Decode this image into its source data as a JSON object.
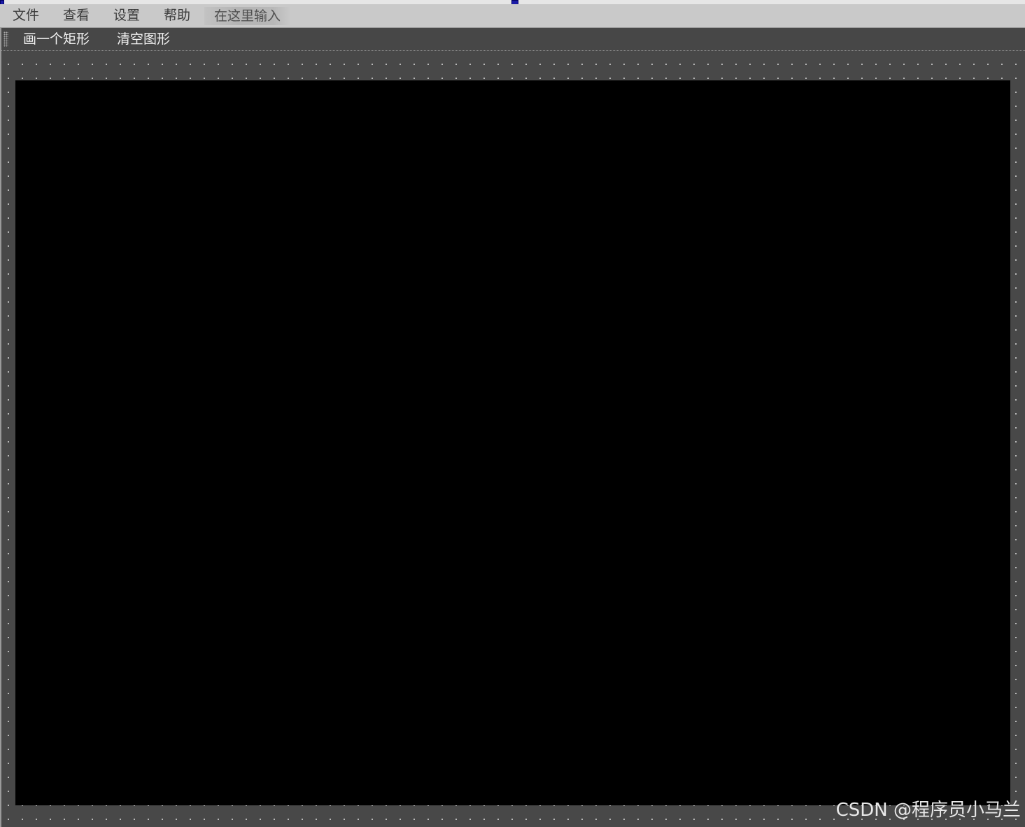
{
  "menubar": {
    "items": [
      {
        "label": "文件"
      },
      {
        "label": "查看"
      },
      {
        "label": "设置"
      },
      {
        "label": "帮助"
      }
    ],
    "placeholder": "在这里输入"
  },
  "toolbar": {
    "actions": [
      {
        "label": "画一个矩形"
      },
      {
        "label": "清空图形"
      }
    ]
  },
  "canvas": {
    "background": "#000000"
  },
  "watermark": "CSDN @程序员小马兰",
  "colors": {
    "menubar_bg": "#c9c9c9",
    "toolbar_bg": "#474747",
    "designer_bg": "#484848",
    "selection_handle": "#1a1aa6"
  }
}
